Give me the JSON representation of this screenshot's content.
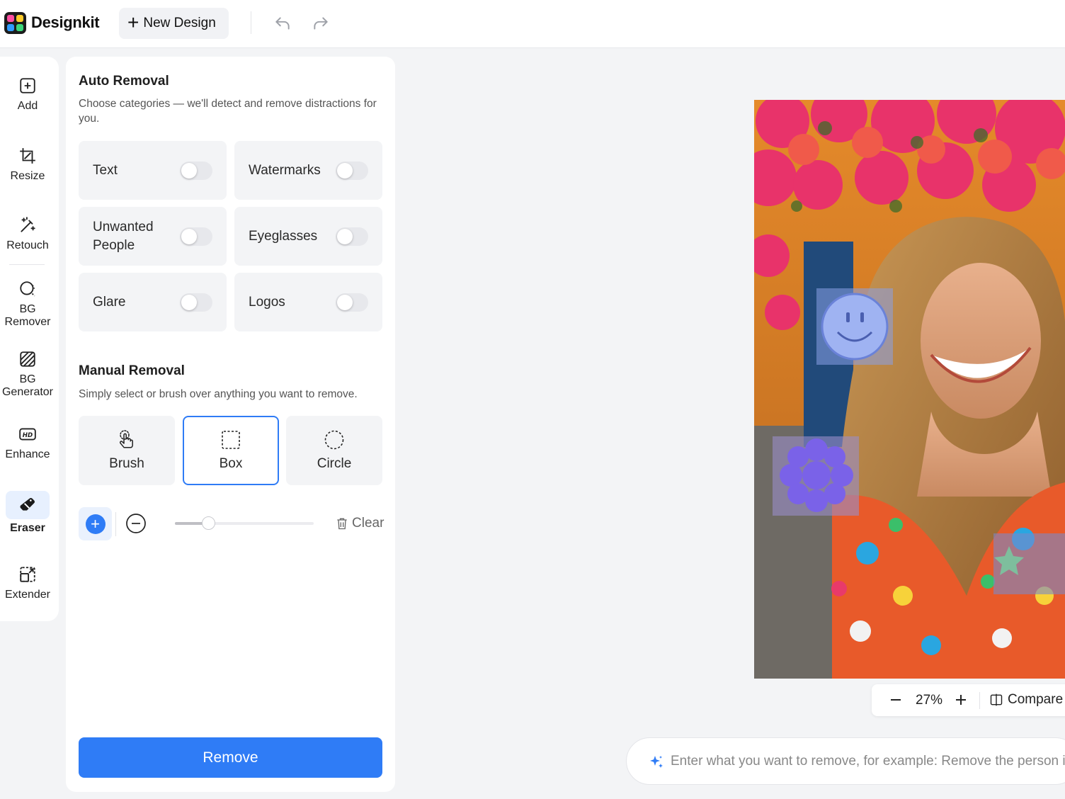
{
  "app": {
    "brand": "Designkit",
    "new_design_label": "New Design"
  },
  "rail": {
    "items": [
      {
        "label": "Add",
        "icon": "add-square-icon"
      },
      {
        "label": "Resize",
        "icon": "crop-icon"
      },
      {
        "label": "Retouch",
        "icon": "magic-wand-icon"
      },
      {
        "label": "BG Remover",
        "icon": "bg-remover-icon"
      },
      {
        "label": "BG Generator",
        "icon": "bg-generator-icon"
      },
      {
        "label": "Enhance",
        "icon": "hd-icon"
      },
      {
        "label": "Eraser",
        "icon": "eraser-icon",
        "active": true
      },
      {
        "label": "Extender",
        "icon": "extender-icon"
      }
    ]
  },
  "auto_removal": {
    "title": "Auto Removal",
    "description": "Choose categories — we'll detect and remove distractions for you.",
    "categories": [
      {
        "label": "Text",
        "on": false
      },
      {
        "label": "Watermarks",
        "on": false
      },
      {
        "label": "Unwanted People",
        "on": false
      },
      {
        "label": "Eyeglasses",
        "on": false
      },
      {
        "label": "Glare",
        "on": false
      },
      {
        "label": "Logos",
        "on": false
      }
    ]
  },
  "manual_removal": {
    "title": "Manual Removal",
    "description": "Simply select or brush over anything you want to remove.",
    "tools": [
      {
        "label": "Brush",
        "icon": "brush-hand-icon"
      },
      {
        "label": "Box",
        "icon": "box-select-icon",
        "selected": true
      },
      {
        "label": "Circle",
        "icon": "circle-select-icon"
      }
    ],
    "brush_size": 0.24,
    "clear_label": "Clear"
  },
  "remove_button": "Remove",
  "zoom": {
    "value": "27%",
    "compare_label": "Compare"
  },
  "prompt": {
    "placeholder": "Enter what you want to remove, for example: Remove the person i"
  },
  "colors": {
    "accent": "#2f7cf6",
    "selected_rail_bg": "#e7f0fe"
  }
}
